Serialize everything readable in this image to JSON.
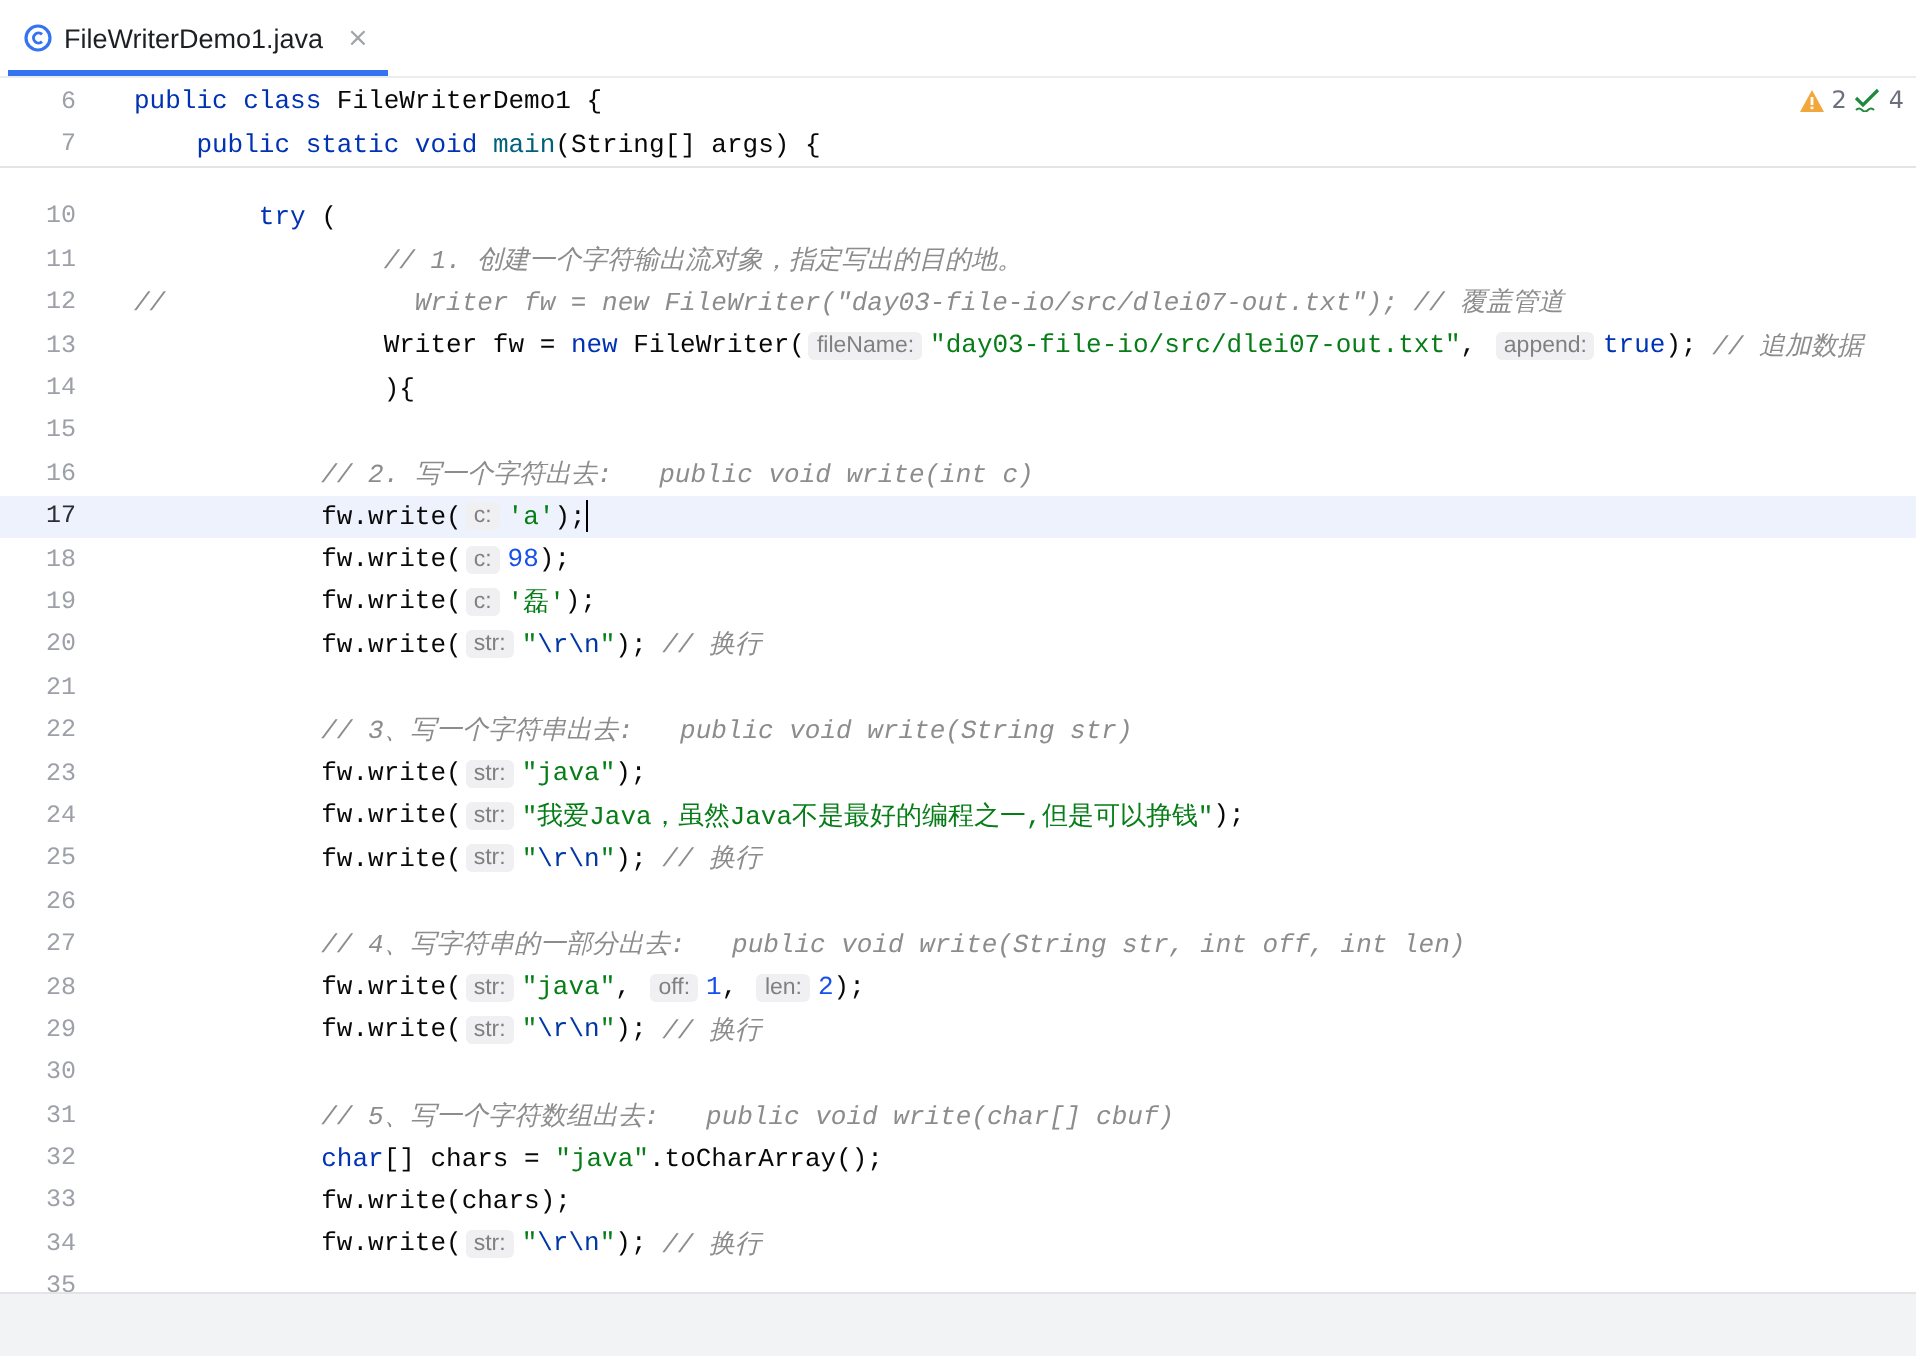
{
  "tab": {
    "title": "FileWriterDemo1.java",
    "close": "×",
    "selected": true
  },
  "inspections": {
    "warnings": "2",
    "checks": "4"
  },
  "sticky_lines": [
    {
      "number": "6",
      "tokens": [
        {
          "kind": "kw",
          "s": "public "
        },
        {
          "kind": "kw",
          "s": "class"
        },
        {
          "kind": "plain",
          "s": " FileWriterDemo1 {"
        }
      ]
    },
    {
      "number": "7",
      "tokens": [
        {
          "kind": "kw",
          "s": "    public static void "
        },
        {
          "kind": "fn",
          "s": "main"
        },
        {
          "kind": "plain",
          "s": "(String[] args) {"
        }
      ]
    }
  ],
  "lines": [
    {
      "number": "10",
      "current": false,
      "tokens": [
        {
          "kind": "kw",
          "s": "        try"
        },
        {
          "kind": "plain",
          "s": " ("
        }
      ]
    },
    {
      "number": "11",
      "current": false,
      "tokens": [
        {
          "kind": "cmt",
          "s": "                // 1. 创建一个字符输出流对象，指定写出的目的地。"
        }
      ]
    },
    {
      "number": "12",
      "current": false,
      "tokens": [
        {
          "kind": "cmt",
          "s": "//                Writer fw = new FileWriter(\"day03-file-io/src/dlei07-out.txt\"); // 覆盖管道"
        }
      ]
    },
    {
      "number": "13",
      "current": false,
      "tokens": [
        {
          "kind": "plain",
          "s": "                Writer fw = "
        },
        {
          "kind": "kw",
          "s": "new"
        },
        {
          "kind": "plain",
          "s": " FileWriter("
        },
        {
          "kind": "hint",
          "s": "fileName:"
        },
        {
          "kind": "str",
          "s": "\"day03-file-io/src/dlei07-out.txt\""
        },
        {
          "kind": "plain",
          "s": ", "
        },
        {
          "kind": "hint",
          "s": "append:"
        },
        {
          "kind": "kw",
          "s": "true"
        },
        {
          "kind": "plain",
          "s": "); "
        },
        {
          "kind": "cmt",
          "s": "// 追加数据"
        }
      ]
    },
    {
      "number": "14",
      "current": false,
      "tokens": [
        {
          "kind": "plain",
          "s": "                ){"
        }
      ]
    },
    {
      "number": "15",
      "current": false
    },
    {
      "number": "16",
      "current": false,
      "tokens": [
        {
          "kind": "cmt",
          "s": "            // 2. 写一个字符出去:   public void write(int c)"
        }
      ]
    },
    {
      "number": "17",
      "current": true,
      "tokens": [
        {
          "kind": "plain",
          "s": "            fw.write("
        },
        {
          "kind": "hint",
          "s": "c:"
        },
        {
          "kind": "str",
          "s": "'a'"
        },
        {
          "kind": "plain",
          "s": ");"
        }
      ]
    },
    {
      "number": "18",
      "current": false,
      "tokens": [
        {
          "kind": "plain",
          "s": "            fw.write("
        },
        {
          "kind": "hint",
          "s": "c:"
        },
        {
          "kind": "num",
          "s": "98"
        },
        {
          "kind": "plain",
          "s": ");"
        }
      ]
    },
    {
      "number": "19",
      "current": false,
      "tokens": [
        {
          "kind": "plain",
          "s": "            fw.write("
        },
        {
          "kind": "hint",
          "s": "c:"
        },
        {
          "kind": "str",
          "s": "'磊'"
        },
        {
          "kind": "plain",
          "s": ");"
        }
      ]
    },
    {
      "number": "20",
      "current": false,
      "tokens": [
        {
          "kind": "plain",
          "s": "            fw.write("
        },
        {
          "kind": "hint",
          "s": "str:"
        },
        {
          "kind": "str",
          "s": "\""
        },
        {
          "kind": "esc",
          "s": "\\r\\n"
        },
        {
          "kind": "str",
          "s": "\""
        },
        {
          "kind": "plain",
          "s": "); "
        },
        {
          "kind": "cmt",
          "s": "// 换行"
        }
      ]
    },
    {
      "number": "21",
      "current": false
    },
    {
      "number": "22",
      "current": false,
      "tokens": [
        {
          "kind": "cmt",
          "s": "            // 3、写一个字符串出去:   public void write(String str)"
        }
      ]
    },
    {
      "number": "23",
      "current": false,
      "tokens": [
        {
          "kind": "plain",
          "s": "            fw.write("
        },
        {
          "kind": "hint",
          "s": "str:"
        },
        {
          "kind": "str",
          "s": "\"java\""
        },
        {
          "kind": "plain",
          "s": ");"
        }
      ]
    },
    {
      "number": "24",
      "current": false,
      "tokens": [
        {
          "kind": "plain",
          "s": "            fw.write("
        },
        {
          "kind": "hint",
          "s": "str:"
        },
        {
          "kind": "str",
          "s": "\"我爱Java，虽然Java不是最好的编程之一,但是可以挣钱\""
        },
        {
          "kind": "plain",
          "s": ");"
        }
      ]
    },
    {
      "number": "25",
      "current": false,
      "tokens": [
        {
          "kind": "plain",
          "s": "            fw.write("
        },
        {
          "kind": "hint",
          "s": "str:"
        },
        {
          "kind": "str",
          "s": "\""
        },
        {
          "kind": "esc",
          "s": "\\r\\n"
        },
        {
          "kind": "str",
          "s": "\""
        },
        {
          "kind": "plain",
          "s": "); "
        },
        {
          "kind": "cmt",
          "s": "// 换行"
        }
      ]
    },
    {
      "number": "26",
      "current": false
    },
    {
      "number": "27",
      "current": false,
      "tokens": [
        {
          "kind": "cmt",
          "s": "            // 4、写字符串的一部分出去:   public void write(String str, int off, int len)"
        }
      ]
    },
    {
      "number": "28",
      "current": false,
      "tokens": [
        {
          "kind": "plain",
          "s": "            fw.write("
        },
        {
          "kind": "hint",
          "s": "str:"
        },
        {
          "kind": "str",
          "s": "\"java\""
        },
        {
          "kind": "plain",
          "s": ", "
        },
        {
          "kind": "hint",
          "s": "off:"
        },
        {
          "kind": "num",
          "s": "1"
        },
        {
          "kind": "plain",
          "s": ", "
        },
        {
          "kind": "hint",
          "s": "len:"
        },
        {
          "kind": "num",
          "s": "2"
        },
        {
          "kind": "plain",
          "s": ");"
        }
      ]
    },
    {
      "number": "29",
      "current": false,
      "tokens": [
        {
          "kind": "plain",
          "s": "            fw.write("
        },
        {
          "kind": "hint",
          "s": "str:"
        },
        {
          "kind": "str",
          "s": "\""
        },
        {
          "kind": "esc",
          "s": "\\r\\n"
        },
        {
          "kind": "str",
          "s": "\""
        },
        {
          "kind": "plain",
          "s": "); "
        },
        {
          "kind": "cmt",
          "s": "// 换行"
        }
      ]
    },
    {
      "number": "30",
      "current": false
    },
    {
      "number": "31",
      "current": false,
      "tokens": [
        {
          "kind": "cmt",
          "s": "            // 5、写一个字符数组出去:   public void write(char[] cbuf)"
        }
      ]
    },
    {
      "number": "32",
      "current": false,
      "tokens": [
        {
          "kind": "kw",
          "s": "            char"
        },
        {
          "kind": "plain",
          "s": "[] chars = "
        },
        {
          "kind": "str",
          "s": "\"java\""
        },
        {
          "kind": "plain",
          "s": ".toCharArray();"
        }
      ]
    },
    {
      "number": "33",
      "current": false,
      "tokens": [
        {
          "kind": "plain",
          "s": "            fw.write(chars);"
        }
      ]
    },
    {
      "number": "34",
      "current": false,
      "tokens": [
        {
          "kind": "plain",
          "s": "            fw.write("
        },
        {
          "kind": "hint",
          "s": "str:"
        },
        {
          "kind": "str",
          "s": "\""
        },
        {
          "kind": "esc",
          "s": "\\r\\n"
        },
        {
          "kind": "str",
          "s": "\""
        },
        {
          "kind": "plain",
          "s": "); "
        },
        {
          "kind": "cmt",
          "s": "// 换行"
        }
      ]
    },
    {
      "number": "35",
      "current": false
    }
  ]
}
